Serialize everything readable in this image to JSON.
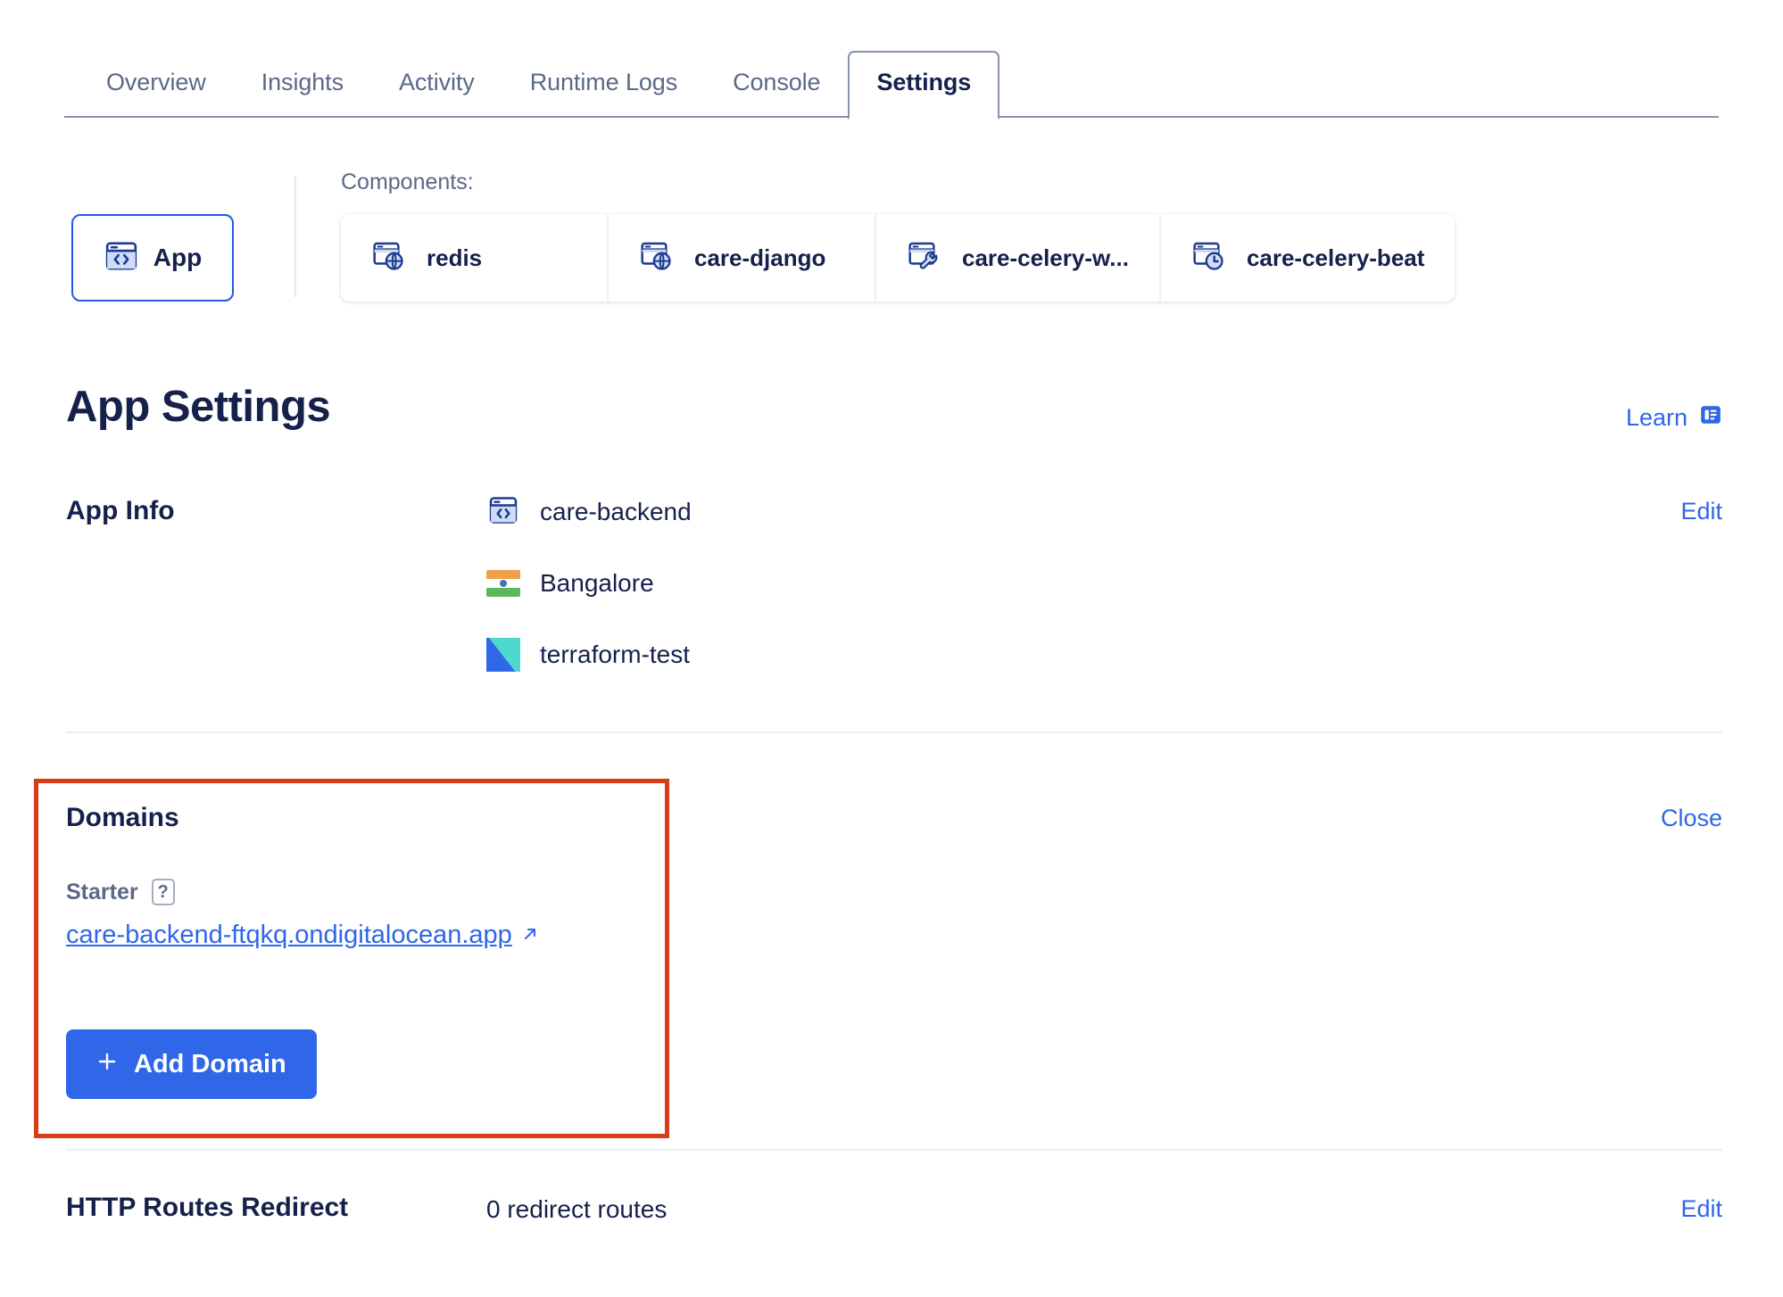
{
  "tabs": [
    {
      "label": "Overview",
      "active": false
    },
    {
      "label": "Insights",
      "active": false
    },
    {
      "label": "Activity",
      "active": false
    },
    {
      "label": "Runtime Logs",
      "active": false
    },
    {
      "label": "Console",
      "active": false
    },
    {
      "label": "Settings",
      "active": true
    }
  ],
  "components_strip": {
    "label": "Components:",
    "app_card": {
      "label": "App",
      "icon": "code-window-icon",
      "selected": true
    },
    "items": [
      {
        "label": "redis",
        "icon": "window-globe-icon"
      },
      {
        "label": "care-django",
        "icon": "window-globe-icon"
      },
      {
        "label": "care-celery-w...",
        "icon": "window-wrench-icon"
      },
      {
        "label": "care-celery-beat",
        "icon": "window-clock-icon"
      }
    ]
  },
  "page": {
    "title": "App Settings",
    "learn_label": "Learn",
    "learn_icon": "article-icon"
  },
  "app_info": {
    "title": "App Info",
    "edit_label": "Edit",
    "rows": [
      {
        "label": "care-backend",
        "icon": "code-window-icon"
      },
      {
        "label": "Bangalore",
        "icon": "flag-india-icon"
      },
      {
        "label": "terraform-test",
        "icon": "terraform-test-logo"
      }
    ]
  },
  "domains": {
    "title": "Domains",
    "close_label": "Close",
    "plan_label": "Starter",
    "help_badge": "?",
    "domain_url": "care-backend-ftqkq.ondigitalocean.app",
    "external_link_icon": "external-link-arrow-icon",
    "add_button_label": "Add Domain",
    "add_button_icon": "plus-icon",
    "highlighted": true
  },
  "http_routes": {
    "title": "HTTP Routes Redirect",
    "value": "0 redirect routes",
    "edit_label": "Edit"
  },
  "colors": {
    "accent_blue": "#2f67e8",
    "dark_navy": "#16214b",
    "muted": "#5b6987",
    "highlight_red": "#d93d18"
  }
}
